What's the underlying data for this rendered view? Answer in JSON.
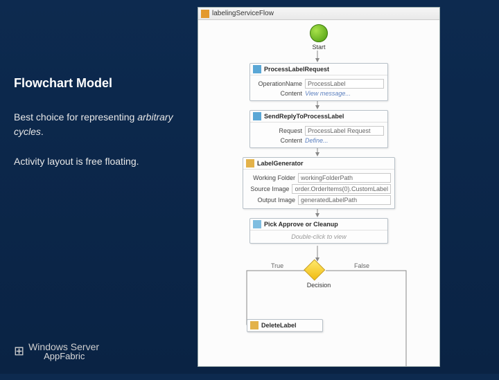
{
  "left": {
    "heading": "Flowchart Model",
    "para1_a": "Best choice for representing ",
    "para1_b": "arbitrary cycles",
    "para1_c": ".",
    "para2": "Activity layout is free floating."
  },
  "logo": {
    "brand": "Windows Server",
    "sub": "AppFabric"
  },
  "designer": {
    "title": "labelingServiceFlow",
    "start_label": "Start",
    "receive": {
      "title": "ProcessLabelRequest",
      "op_lbl": "OperationName",
      "op_val": "ProcessLabel",
      "content_lbl": "Content",
      "content_link": "View message..."
    },
    "reply": {
      "title": "SendReplyToProcessLabel",
      "req_lbl": "Request",
      "req_val": "ProcessLabel Request",
      "content_lbl": "Content",
      "content_link": "Define..."
    },
    "gen": {
      "title": "LabelGenerator",
      "wf_lbl": "Working Folder",
      "wf_val": "workingFolderPath",
      "src_lbl": "Source Image",
      "src_val": "order.OrderItems(0).CustomLabel",
      "out_lbl": "Output Image",
      "out_val": "generatedLabelPath"
    },
    "pick": {
      "title": "Pick Approve or Cleanup",
      "hint": "Double-click to view"
    },
    "decision": {
      "true": "True",
      "false": "False",
      "label": "Decision"
    },
    "delete": {
      "title": "DeleteLabel"
    }
  }
}
